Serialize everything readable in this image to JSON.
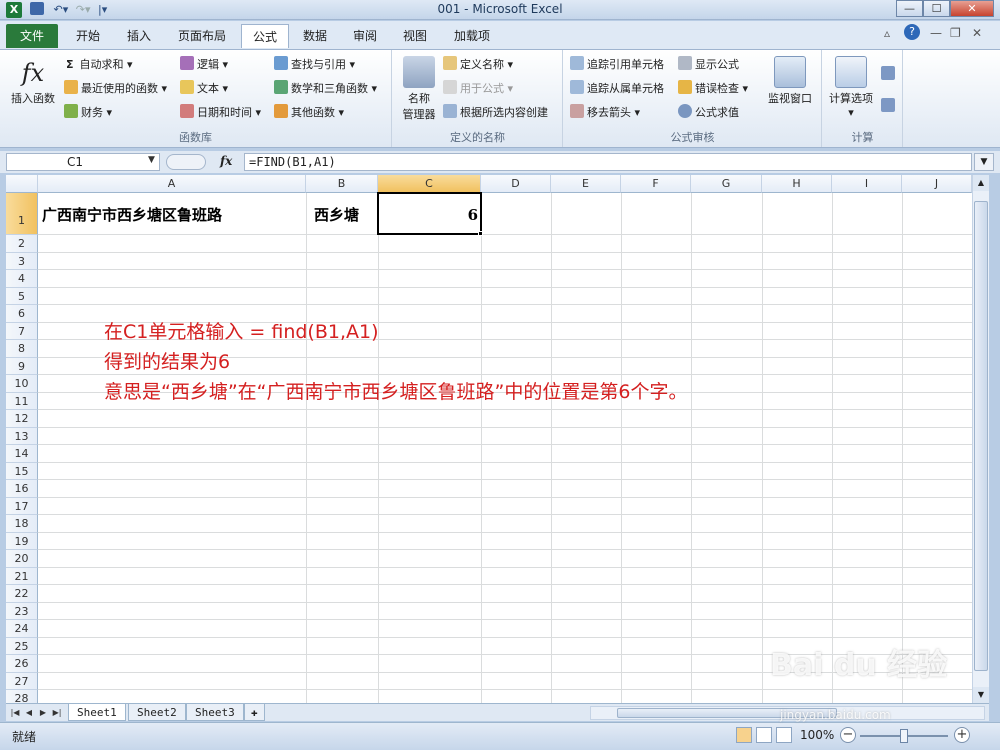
{
  "window": {
    "title": "001 - Microsoft Excel"
  },
  "menu": {
    "file": "文件",
    "tabs": [
      "开始",
      "插入",
      "页面布局",
      "公式",
      "数据",
      "审阅",
      "视图",
      "加载项"
    ],
    "active_tab": "公式"
  },
  "ribbon": {
    "function_library": {
      "label": "函数库",
      "insert_function": "插入函数",
      "autosum": "自动求和",
      "recent": "最近使用的函数",
      "financial": "财务",
      "logical": "逻辑",
      "text": "文本",
      "datetime": "日期和时间",
      "lookup": "查找与引用",
      "math": "数学和三角函数",
      "more": "其他函数"
    },
    "defined_names": {
      "label": "定义的名称",
      "name_manager_1": "名称",
      "name_manager_2": "管理器",
      "define_name": "定义名称",
      "use_in_formula": "用于公式",
      "create_from_selection": "根据所选内容创建"
    },
    "formula_auditing": {
      "label": "公式审核",
      "trace_precedents": "追踪引用单元格",
      "trace_dependents": "追踪从属单元格",
      "remove_arrows": "移去箭头",
      "show_formulas": "显示公式",
      "error_checking": "错误检查",
      "evaluate": "公式求值",
      "watch_window": "监视窗口"
    },
    "calculation": {
      "label": "计算",
      "options": "计算选项"
    }
  },
  "formula_bar": {
    "name_box": "C1",
    "fx": "fx",
    "formula": "=FIND(B1,A1)"
  },
  "grid": {
    "columns": [
      "A",
      "B",
      "C",
      "D",
      "E",
      "F",
      "G",
      "H",
      "I",
      "J"
    ],
    "rows": [
      "1",
      "2",
      "3",
      "4",
      "5",
      "6",
      "7",
      "8",
      "9",
      "10",
      "11",
      "12",
      "13",
      "14",
      "15",
      "16",
      "17",
      "18",
      "19",
      "20",
      "21",
      "22",
      "23",
      "24",
      "25",
      "26",
      "27",
      "28"
    ],
    "cells": {
      "A1": "广西南宁市西乡塘区鲁班路",
      "B1": "西乡塘",
      "C1": "6"
    },
    "active_cell": "C1"
  },
  "annotation": {
    "line1": "在C1单元格输入 = find(B1,A1)",
    "line2": "得到的结果为6",
    "line3": "意思是“西乡塘”在“广西南宁市西乡塘区鲁班路”中的位置是第6个字。"
  },
  "sheets": [
    "Sheet1",
    "Sheet2",
    "Sheet3"
  ],
  "active_sheet": "Sheet1",
  "status": {
    "ready": "就绪",
    "zoom": "100%"
  },
  "watermark": {
    "brand": "Bai du 经验",
    "url": "jingyan.baidu.com"
  }
}
